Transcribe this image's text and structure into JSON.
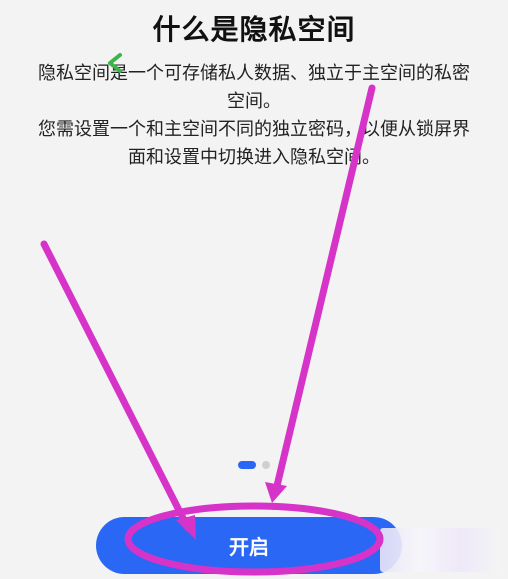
{
  "page": {
    "title": "什么是隐私空间",
    "desc1_line1": "隐私空间是一个可存储私人数据、独立于主空间的私密",
    "desc1_line2": "空间。",
    "desc2_line1": "您需设置一个和主空间不同的独立密码，以便从锁屏界",
    "desc2_line2": "面和设置中切换进入隐私空间。"
  },
  "pager": {
    "count": 2,
    "active_index": 0
  },
  "action": {
    "open_label": "开启"
  },
  "colors": {
    "accent": "#2a67f5",
    "annotation": "#d633c9",
    "chevron": "#3bb44a",
    "background": "#f3f3f3"
  },
  "icons": {
    "chevron": "chevron-left-icon"
  }
}
